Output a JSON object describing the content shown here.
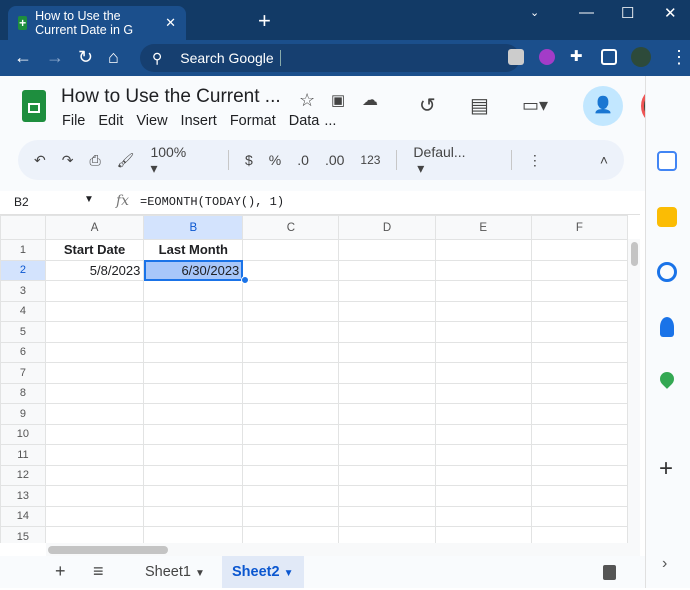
{
  "browser": {
    "tab_title": "How to Use the Current Date in G",
    "new_tab": "+",
    "close": "✕",
    "search_placeholder": "Search Google"
  },
  "doc": {
    "title": "How to Use the Current ...",
    "menus": [
      "File",
      "Edit",
      "View",
      "Insert",
      "Format",
      "Data",
      "..."
    ]
  },
  "toolbar": {
    "zoom": "100%",
    "currency": "$",
    "percent": "%",
    "dec_decrease": ".0",
    "dec_increase": ".00",
    "number_format": "123",
    "font": "Defaul..."
  },
  "formula_bar": {
    "name_box": "B2",
    "fx": "fx",
    "formula": "=EOMONTH(TODAY(), 1)"
  },
  "grid": {
    "columns": [
      "A",
      "B",
      "C",
      "D",
      "E",
      "F"
    ],
    "rows": [
      "1",
      "2",
      "3",
      "4",
      "5",
      "6",
      "7",
      "8",
      "9",
      "10",
      "11",
      "12",
      "13",
      "14",
      "15"
    ],
    "cells": {
      "A1": "Start Date",
      "B1": "Last Month",
      "A2": "5/8/2023",
      "B2": "6/30/2023"
    }
  },
  "sheets": {
    "tabs": [
      "Sheet1",
      "Sheet2"
    ],
    "active": "Sheet2"
  }
}
